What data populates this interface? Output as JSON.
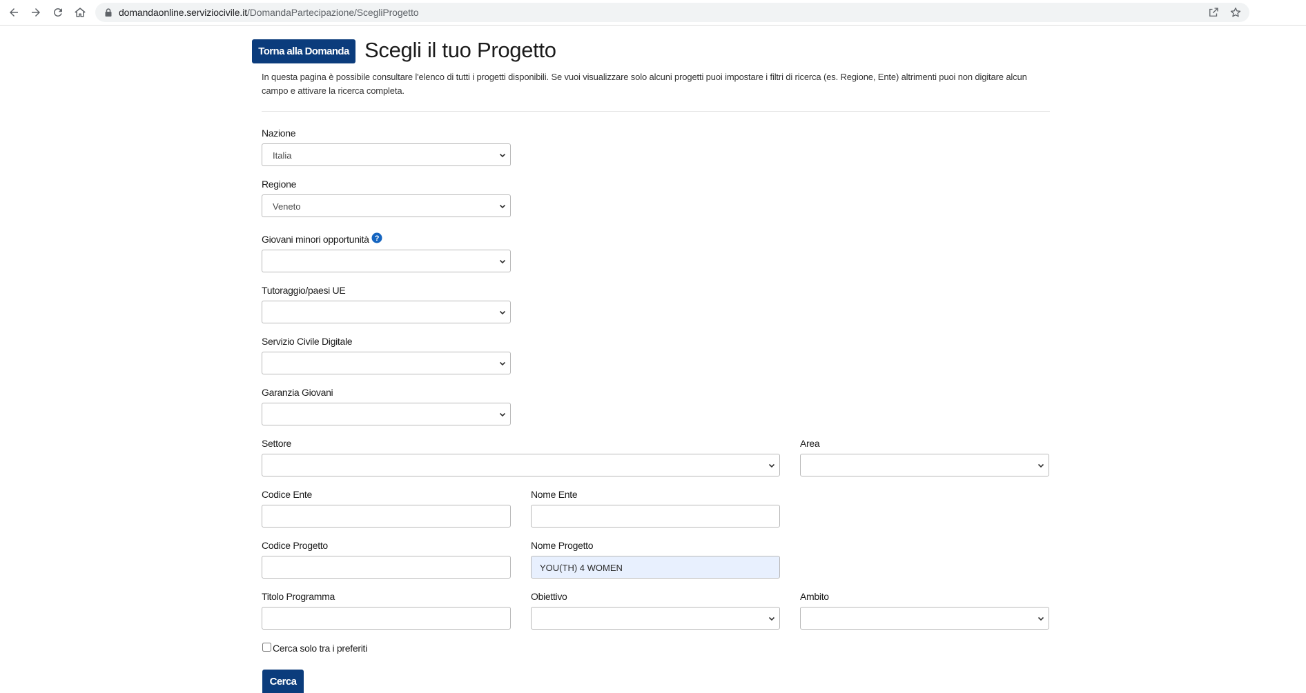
{
  "browser": {
    "url_host": "domandaonline.serviziocivile.it",
    "url_path": "/DomandaPartecipazione/ScegliProgetto"
  },
  "page": {
    "back_button": "Torna alla Domanda",
    "title": "Scegli il tuo Progetto",
    "intro": "In questa pagina è possibile consultare l'elenco di tutti i progetti disponibili. Se vuoi visualizzare solo alcuni progetti puoi impostare i filtri di ricerca (es. Regione, Ente) altrimenti puoi non digitare alcun campo e attivare la ricerca completa."
  },
  "form": {
    "nazione": {
      "label": "Nazione",
      "value": "Italia"
    },
    "regione": {
      "label": "Regione",
      "value": "Veneto"
    },
    "giovani_minori": {
      "label": "Giovani minori opportunità",
      "value": ""
    },
    "tutoraggio": {
      "label": "Tutoraggio/paesi UE",
      "value": ""
    },
    "digitale": {
      "label": "Servizio Civile Digitale",
      "value": ""
    },
    "garanzia": {
      "label": "Garanzia Giovani",
      "value": ""
    },
    "settore": {
      "label": "Settore",
      "value": ""
    },
    "area": {
      "label": "Area",
      "value": ""
    },
    "codice_ente": {
      "label": "Codice Ente",
      "value": ""
    },
    "nome_ente": {
      "label": "Nome Ente",
      "value": ""
    },
    "codice_progetto": {
      "label": "Codice Progetto",
      "value": ""
    },
    "nome_progetto": {
      "label": "Nome Progetto",
      "value": "YOU(TH) 4 WOMEN"
    },
    "titolo_programma": {
      "label": "Titolo Programma",
      "value": ""
    },
    "obiettivo": {
      "label": "Obiettivo",
      "value": ""
    },
    "ambito": {
      "label": "Ambito",
      "value": ""
    },
    "preferiti": {
      "label": "Cerca solo tra i preferiti",
      "checked": false
    },
    "submit": "Cerca"
  },
  "colors": {
    "primary": "#0b3c7c",
    "help_icon": "#1565c0",
    "autofill": "#e8f0fe"
  },
  "icons": [
    "back-arrow-icon",
    "forward-arrow-icon",
    "reload-icon",
    "home-icon",
    "lock-icon",
    "share-icon",
    "star-icon",
    "question-help-icon",
    "chevron-down-icon"
  ]
}
